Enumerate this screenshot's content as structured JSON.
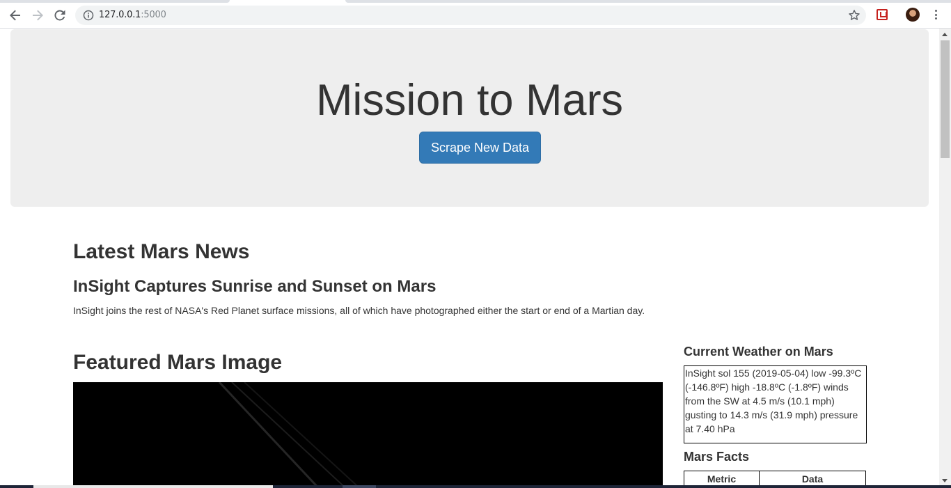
{
  "browser": {
    "url_host": "127.0.0.1",
    "url_port": ":5000",
    "icons": [
      "back-icon",
      "forward-icon",
      "reload-icon",
      "info-icon",
      "star-icon",
      "extension-icon",
      "avatar",
      "menu-icon"
    ]
  },
  "jumbotron": {
    "title": "Mission to Mars",
    "button_label": "Scrape New Data",
    "button_color": "#337ab7",
    "background": "#eeeeee"
  },
  "news": {
    "section_title": "Latest Mars News",
    "headline": "InSight Captures Sunrise and Sunset on Mars",
    "paragraph": "InSight joins the rest of NASA's Red Planet surface missions, all of which have photographed either the start or end of a Martian day."
  },
  "featured": {
    "section_title": "Featured Mars Image"
  },
  "weather": {
    "section_title": "Current Weather on Mars",
    "text": "InSight sol 155 (2019-05-04) low -99.3ºC (-146.8ºF) high -18.8ºC (-1.8ºF) winds from the SW at 4.5 m/s (10.1 mph) gusting to 14.3 m/s (31.9 mph) pressure at 7.40 hPa"
  },
  "facts": {
    "section_title": "Mars Facts",
    "columns": [
      "Metric",
      "Data"
    ]
  }
}
